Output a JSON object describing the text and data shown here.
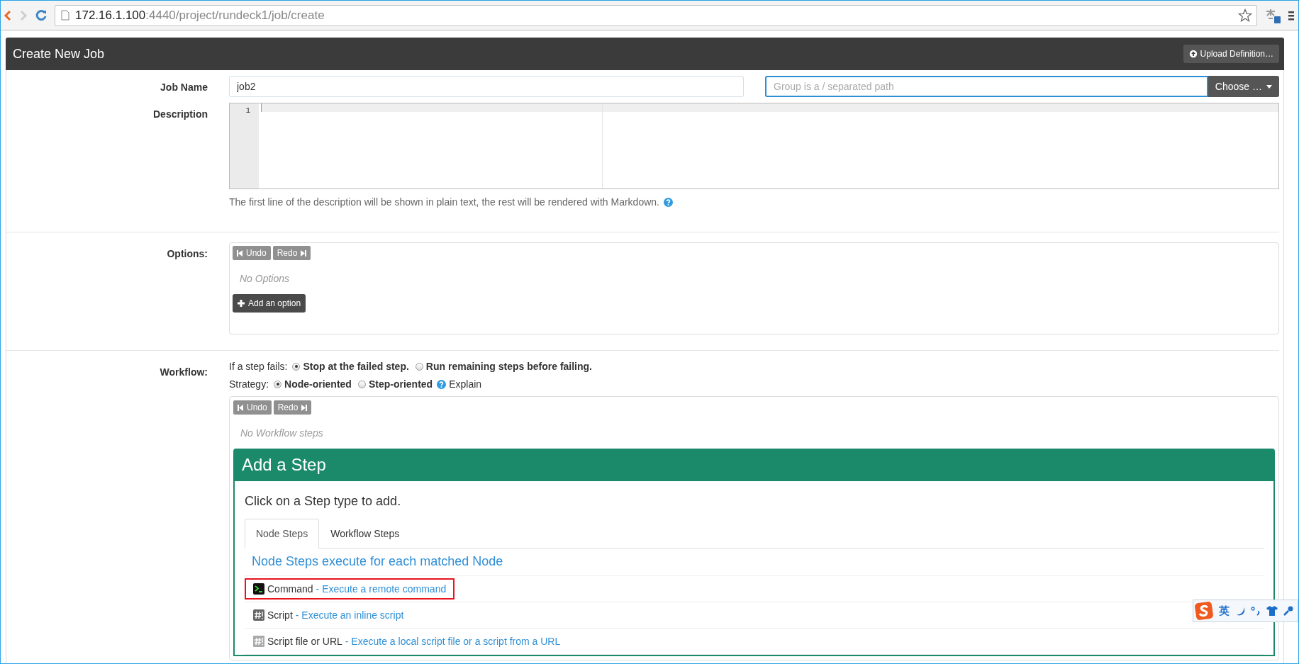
{
  "browser": {
    "url_host": "172.16.1.100",
    "url_path": ":4440/project/rundeck1/job/create"
  },
  "header": {
    "title": "Create New Job",
    "upload_button": "Upload Definition…"
  },
  "job_name": {
    "label": "Job Name",
    "value": "job2"
  },
  "group": {
    "placeholder": "Group is a / separated path",
    "choose_button": "Choose …"
  },
  "description": {
    "label": "Description",
    "line_number": "1",
    "help": "The first line of the description will be shown in plain text, the rest will be rendered with Markdown."
  },
  "options": {
    "label": "Options:",
    "undo": "Undo",
    "redo": "Redo",
    "empty": "No Options",
    "add_button": "Add an option"
  },
  "workflow": {
    "label": "Workflow:",
    "on_fail": {
      "prefix": "If a step fails:",
      "choices": [
        {
          "label": "Stop at the failed step.",
          "selected": true
        },
        {
          "label": "Run remaining steps before failing.",
          "selected": false
        }
      ]
    },
    "strategy": {
      "prefix": "Strategy:",
      "choices": [
        {
          "label": "Node-oriented",
          "selected": true
        },
        {
          "label": "Step-oriented",
          "selected": false
        }
      ],
      "explain": "Explain"
    },
    "undo": "Undo",
    "redo": "Redo",
    "empty": "No Workflow steps",
    "add_step": {
      "title": "Add a Step",
      "prompt": "Click on a Step type to add.",
      "tabs": [
        {
          "label": "Node Steps",
          "selected": true
        },
        {
          "label": "Workflow Steps",
          "selected": false
        }
      ],
      "heading": "Node Steps execute for each matched Node",
      "steps": [
        {
          "kind": "command",
          "name": "Command",
          "separator": "-",
          "description": "Execute a remote command",
          "highlighted": true
        },
        {
          "kind": "script",
          "name": "Script",
          "separator": "-",
          "description": "Execute an inline script",
          "highlighted": false
        },
        {
          "kind": "scriptfile",
          "name": "Script file or URL",
          "separator": "-",
          "description": "Execute a local script file or a script from a URL",
          "highlighted": false
        }
      ]
    }
  },
  "ime": {
    "label": "英"
  }
}
